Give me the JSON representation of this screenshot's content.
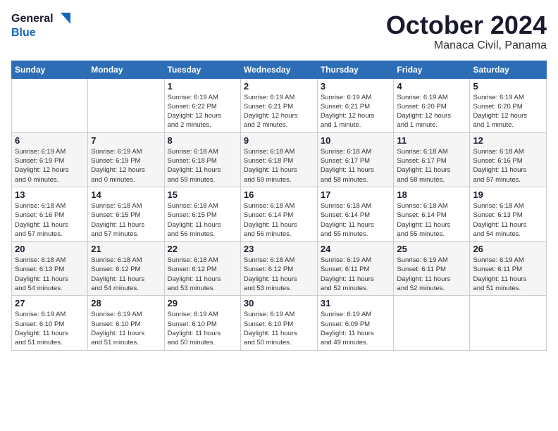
{
  "logo": {
    "line1": "General",
    "line2": "Blue"
  },
  "header": {
    "month": "October 2024",
    "location": "Manaca Civil, Panama"
  },
  "weekdays": [
    "Sunday",
    "Monday",
    "Tuesday",
    "Wednesday",
    "Thursday",
    "Friday",
    "Saturday"
  ],
  "weeks": [
    [
      {
        "day": "",
        "info": ""
      },
      {
        "day": "",
        "info": ""
      },
      {
        "day": "1",
        "info": "Sunrise: 6:19 AM\nSunset: 6:22 PM\nDaylight: 12 hours\nand 2 minutes."
      },
      {
        "day": "2",
        "info": "Sunrise: 6:19 AM\nSunset: 6:21 PM\nDaylight: 12 hours\nand 2 minutes."
      },
      {
        "day": "3",
        "info": "Sunrise: 6:19 AM\nSunset: 6:21 PM\nDaylight: 12 hours\nand 1 minute."
      },
      {
        "day": "4",
        "info": "Sunrise: 6:19 AM\nSunset: 6:20 PM\nDaylight: 12 hours\nand 1 minute."
      },
      {
        "day": "5",
        "info": "Sunrise: 6:19 AM\nSunset: 6:20 PM\nDaylight: 12 hours\nand 1 minute."
      }
    ],
    [
      {
        "day": "6",
        "info": "Sunrise: 6:19 AM\nSunset: 6:19 PM\nDaylight: 12 hours\nand 0 minutes."
      },
      {
        "day": "7",
        "info": "Sunrise: 6:19 AM\nSunset: 6:19 PM\nDaylight: 12 hours\nand 0 minutes."
      },
      {
        "day": "8",
        "info": "Sunrise: 6:18 AM\nSunset: 6:18 PM\nDaylight: 11 hours\nand 59 minutes."
      },
      {
        "day": "9",
        "info": "Sunrise: 6:18 AM\nSunset: 6:18 PM\nDaylight: 11 hours\nand 59 minutes."
      },
      {
        "day": "10",
        "info": "Sunrise: 6:18 AM\nSunset: 6:17 PM\nDaylight: 11 hours\nand 58 minutes."
      },
      {
        "day": "11",
        "info": "Sunrise: 6:18 AM\nSunset: 6:17 PM\nDaylight: 11 hours\nand 58 minutes."
      },
      {
        "day": "12",
        "info": "Sunrise: 6:18 AM\nSunset: 6:16 PM\nDaylight: 11 hours\nand 57 minutes."
      }
    ],
    [
      {
        "day": "13",
        "info": "Sunrise: 6:18 AM\nSunset: 6:16 PM\nDaylight: 11 hours\nand 57 minutes."
      },
      {
        "day": "14",
        "info": "Sunrise: 6:18 AM\nSunset: 6:15 PM\nDaylight: 11 hours\nand 57 minutes."
      },
      {
        "day": "15",
        "info": "Sunrise: 6:18 AM\nSunset: 6:15 PM\nDaylight: 11 hours\nand 56 minutes."
      },
      {
        "day": "16",
        "info": "Sunrise: 6:18 AM\nSunset: 6:14 PM\nDaylight: 11 hours\nand 56 minutes."
      },
      {
        "day": "17",
        "info": "Sunrise: 6:18 AM\nSunset: 6:14 PM\nDaylight: 11 hours\nand 55 minutes."
      },
      {
        "day": "18",
        "info": "Sunrise: 6:18 AM\nSunset: 6:14 PM\nDaylight: 11 hours\nand 55 minutes."
      },
      {
        "day": "19",
        "info": "Sunrise: 6:18 AM\nSunset: 6:13 PM\nDaylight: 11 hours\nand 54 minutes."
      }
    ],
    [
      {
        "day": "20",
        "info": "Sunrise: 6:18 AM\nSunset: 6:13 PM\nDaylight: 11 hours\nand 54 minutes."
      },
      {
        "day": "21",
        "info": "Sunrise: 6:18 AM\nSunset: 6:12 PM\nDaylight: 11 hours\nand 54 minutes."
      },
      {
        "day": "22",
        "info": "Sunrise: 6:18 AM\nSunset: 6:12 PM\nDaylight: 11 hours\nand 53 minutes."
      },
      {
        "day": "23",
        "info": "Sunrise: 6:18 AM\nSunset: 6:12 PM\nDaylight: 11 hours\nand 53 minutes."
      },
      {
        "day": "24",
        "info": "Sunrise: 6:19 AM\nSunset: 6:11 PM\nDaylight: 11 hours\nand 52 minutes."
      },
      {
        "day": "25",
        "info": "Sunrise: 6:19 AM\nSunset: 6:11 PM\nDaylight: 11 hours\nand 52 minutes."
      },
      {
        "day": "26",
        "info": "Sunrise: 6:19 AM\nSunset: 6:11 PM\nDaylight: 11 hours\nand 51 minutes."
      }
    ],
    [
      {
        "day": "27",
        "info": "Sunrise: 6:19 AM\nSunset: 6:10 PM\nDaylight: 11 hours\nand 51 minutes."
      },
      {
        "day": "28",
        "info": "Sunrise: 6:19 AM\nSunset: 6:10 PM\nDaylight: 11 hours\nand 51 minutes."
      },
      {
        "day": "29",
        "info": "Sunrise: 6:19 AM\nSunset: 6:10 PM\nDaylight: 11 hours\nand 50 minutes."
      },
      {
        "day": "30",
        "info": "Sunrise: 6:19 AM\nSunset: 6:10 PM\nDaylight: 11 hours\nand 50 minutes."
      },
      {
        "day": "31",
        "info": "Sunrise: 6:19 AM\nSunset: 6:09 PM\nDaylight: 11 hours\nand 49 minutes."
      },
      {
        "day": "",
        "info": ""
      },
      {
        "day": "",
        "info": ""
      }
    ]
  ]
}
